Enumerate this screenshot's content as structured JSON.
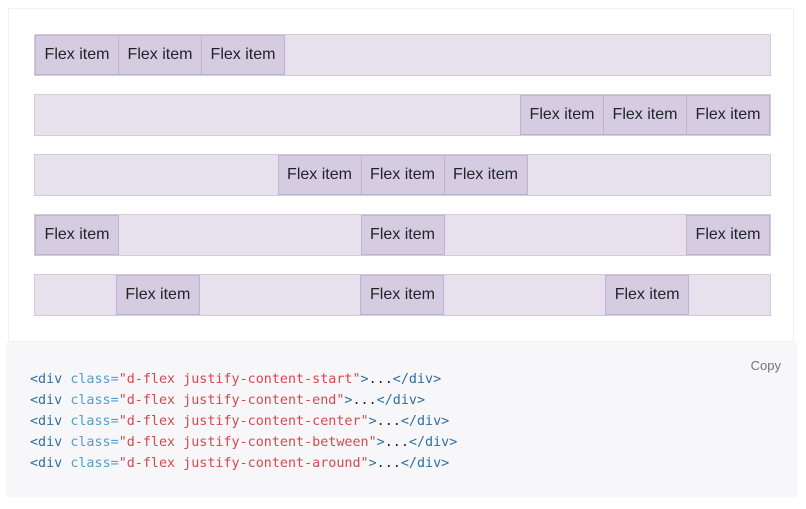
{
  "examples": {
    "item_label": "Flex item",
    "rows": [
      {
        "name": "justify-start",
        "items": [
          "Flex item",
          "Flex item",
          "Flex item"
        ]
      },
      {
        "name": "justify-end",
        "items": [
          "Flex item",
          "Flex item",
          "Flex item"
        ]
      },
      {
        "name": "justify-center",
        "items": [
          "Flex item",
          "Flex item",
          "Flex item"
        ]
      },
      {
        "name": "justify-between",
        "items": [
          "Flex item",
          "Flex item",
          "Flex item"
        ]
      },
      {
        "name": "justify-around",
        "items": [
          "Flex item",
          "Flex item",
          "Flex item"
        ]
      }
    ]
  },
  "code": {
    "copy_label": "Copy",
    "lines": [
      {
        "open": "<div ",
        "attr": "class=",
        "value": "\"d-flex justify-content-start\"",
        "gt": ">",
        "content": "...",
        "close": "</div>"
      },
      {
        "open": "<div ",
        "attr": "class=",
        "value": "\"d-flex justify-content-end\"",
        "gt": ">",
        "content": "...",
        "close": "</div>"
      },
      {
        "open": "<div ",
        "attr": "class=",
        "value": "\"d-flex justify-content-center\"",
        "gt": ">",
        "content": "...",
        "close": "</div>"
      },
      {
        "open": "<div ",
        "attr": "class=",
        "value": "\"d-flex justify-content-between\"",
        "gt": ">",
        "content": "...",
        "close": "</div>"
      },
      {
        "open": "<div ",
        "attr": "class=",
        "value": "\"d-flex justify-content-around\"",
        "gt": ">",
        "content": "...",
        "close": "</div>"
      }
    ]
  }
}
